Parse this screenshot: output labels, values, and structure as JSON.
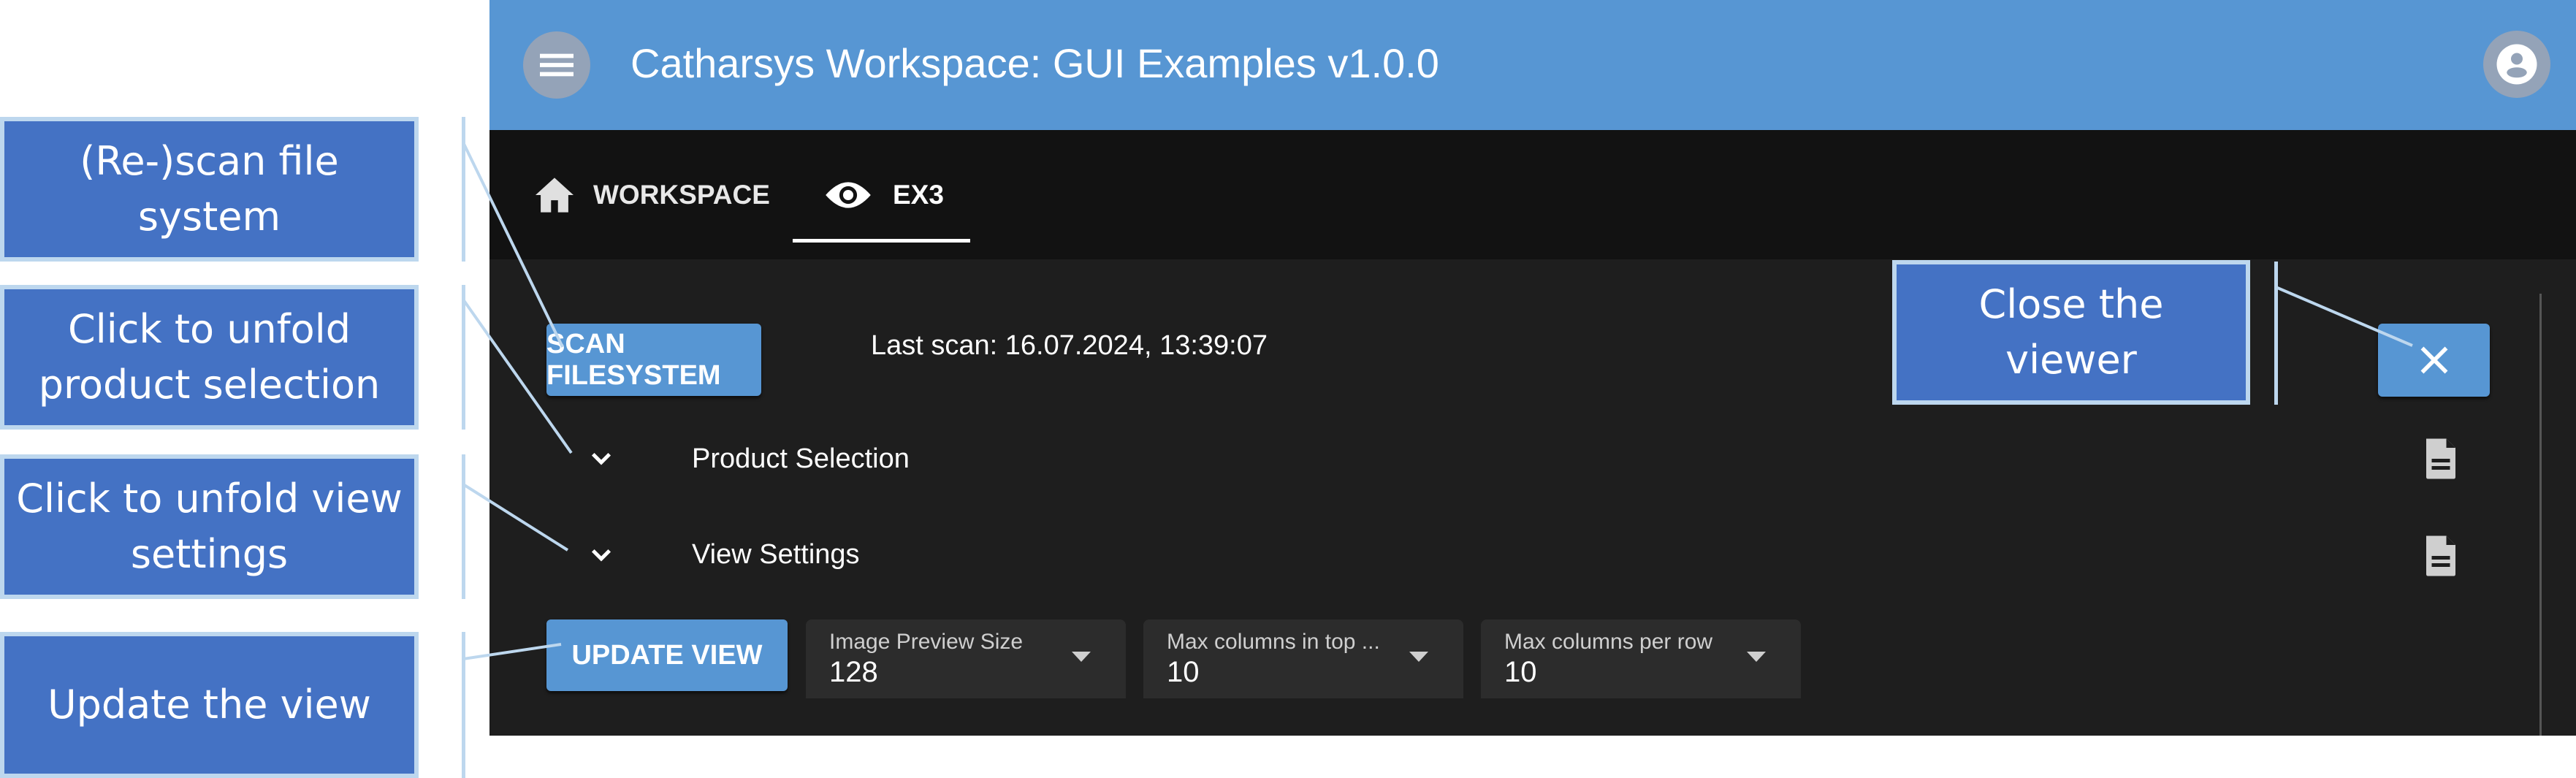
{
  "callouts": [
    {
      "text": "(Re-)scan file system"
    },
    {
      "text": "Click to unfold product selection"
    },
    {
      "text": "Click to unfold view settings"
    },
    {
      "text": "Update the view"
    },
    {
      "text": "Close the viewer"
    }
  ],
  "header": {
    "title": "Catharsys Workspace: GUI Examples v1.0.0",
    "menu_icon": "hamburger-menu-icon",
    "account_icon": "account-circle-icon"
  },
  "tabs": [
    {
      "label": "WORKSPACE",
      "icon": "home-icon",
      "active": false
    },
    {
      "label": "EX3",
      "icon": "eye-icon",
      "active": true
    }
  ],
  "toolbar": {
    "scan_label": "SCAN FILESYSTEM",
    "last_scan": "Last scan: 16.07.2024, 13:39:07",
    "close_icon": "close-icon"
  },
  "sections": [
    {
      "label": "Product Selection",
      "expanded": false
    },
    {
      "label": "View Settings",
      "expanded": false
    }
  ],
  "view": {
    "update_label": "UPDATE VIEW",
    "selects": [
      {
        "label": "Image Preview Size",
        "value": "128"
      },
      {
        "label": "Max columns in top ...",
        "value": "10"
      },
      {
        "label": "Max columns per row",
        "value": "10"
      }
    ]
  },
  "colors": {
    "primary": "#5796d3",
    "callout": "#4472c4",
    "callout_border": "#bdd7ee",
    "panel": "#1e1e1e",
    "tabbar": "#121212"
  }
}
